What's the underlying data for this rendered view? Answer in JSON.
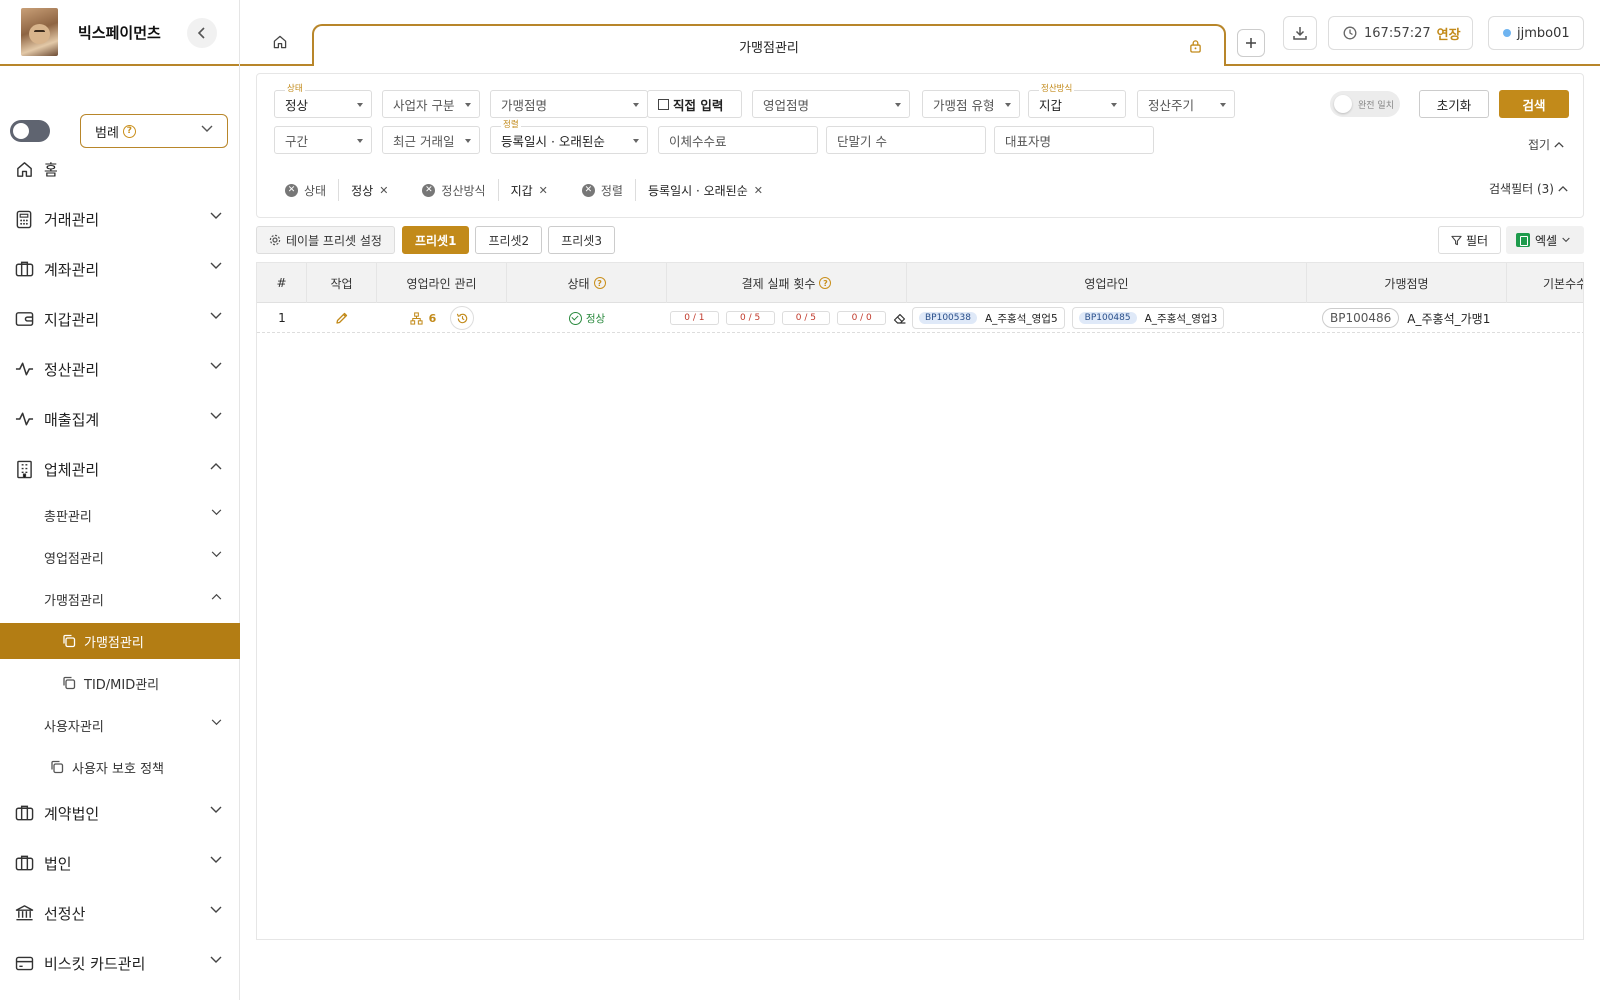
{
  "brand": {
    "name": "빅스페이먼츠"
  },
  "sidebar": {
    "legend_label": "범례",
    "nav": [
      {
        "label": "홈"
      },
      {
        "label": "거래관리"
      },
      {
        "label": "계좌관리"
      },
      {
        "label": "지갑관리"
      },
      {
        "label": "정산관리"
      },
      {
        "label": "매출집계"
      },
      {
        "label": "업체관리"
      },
      {
        "label": "계약법인"
      },
      {
        "label": "법인"
      },
      {
        "label": "선정산"
      },
      {
        "label": "비스킷 카드관리"
      }
    ],
    "sub": {
      "distributor": "총판관리",
      "sales_office": "영업점관리",
      "merchant": "가맹점관리",
      "merchant_leaf": "가맹점관리",
      "tidmid_leaf": "TID/MID관리",
      "user": "사용자관리",
      "user_policy_leaf": "사용자 보호 정책"
    }
  },
  "topbar": {
    "tab_title": "가맹점관리",
    "timer": "167:57:27",
    "extend_label": "연장",
    "username": "jjmbo01"
  },
  "filters": {
    "status": {
      "label": "상태",
      "value": "정상"
    },
    "biz_type": {
      "placeholder": "사업자 구분"
    },
    "merchant_name": {
      "placeholder": "가맹점명"
    },
    "direct_input": "직접 입력",
    "sales_name": {
      "placeholder": "영업점명"
    },
    "merchant_type": {
      "placeholder": "가맹점 유형"
    },
    "settle_method": {
      "label": "정산방식",
      "value": "지갑"
    },
    "settle_cycle": {
      "placeholder": "정산주기"
    },
    "exact_match": "완전 일치",
    "reset_label": "초기화",
    "search_label": "검색",
    "section": {
      "placeholder": "구간"
    },
    "recent_tx": {
      "placeholder": "최근 거래일"
    },
    "sort": {
      "label": "정렬",
      "value": "등록일시 · 오래된순"
    },
    "transfer_fee": {
      "placeholder": "이체수수료"
    },
    "terminal_count": {
      "placeholder": "단말기 수"
    },
    "ceo_name": {
      "placeholder": "대표자명"
    },
    "fold_label": "접기",
    "search_filter_label": "검색필터 (3)",
    "chips": [
      {
        "key": "상태",
        "value": "정상"
      },
      {
        "key": "정산방식",
        "value": "지갑"
      },
      {
        "key": "정렬",
        "value": "등록일시 · 오래된순"
      }
    ]
  },
  "presets": {
    "settings_label": "테이블 프리셋 설정",
    "items": [
      "프리셋1",
      "프리셋2",
      "프리셋3"
    ],
    "filter_label": "필터",
    "excel_label": "엑셀"
  },
  "table": {
    "headers": [
      "#",
      "작업",
      "영업라인 관리",
      "상태",
      "결제 실패 횟수",
      "영업라인",
      "가맹점명",
      "기본수수"
    ],
    "rows": [
      {
        "index": "1",
        "line_count": "6",
        "status": "정상",
        "fails": [
          "0 / 1",
          "0 / 5",
          "0 / 5",
          "0 / 0"
        ],
        "sales_lines": [
          {
            "code": "BP100538",
            "name": "A_주홍석_영업5"
          },
          {
            "code": "BP100485",
            "name": "A_주홍석_영업3"
          }
        ],
        "merchant_code": "BP100486",
        "merchant_name": "A_주홍석_가맹1"
      }
    ]
  }
}
